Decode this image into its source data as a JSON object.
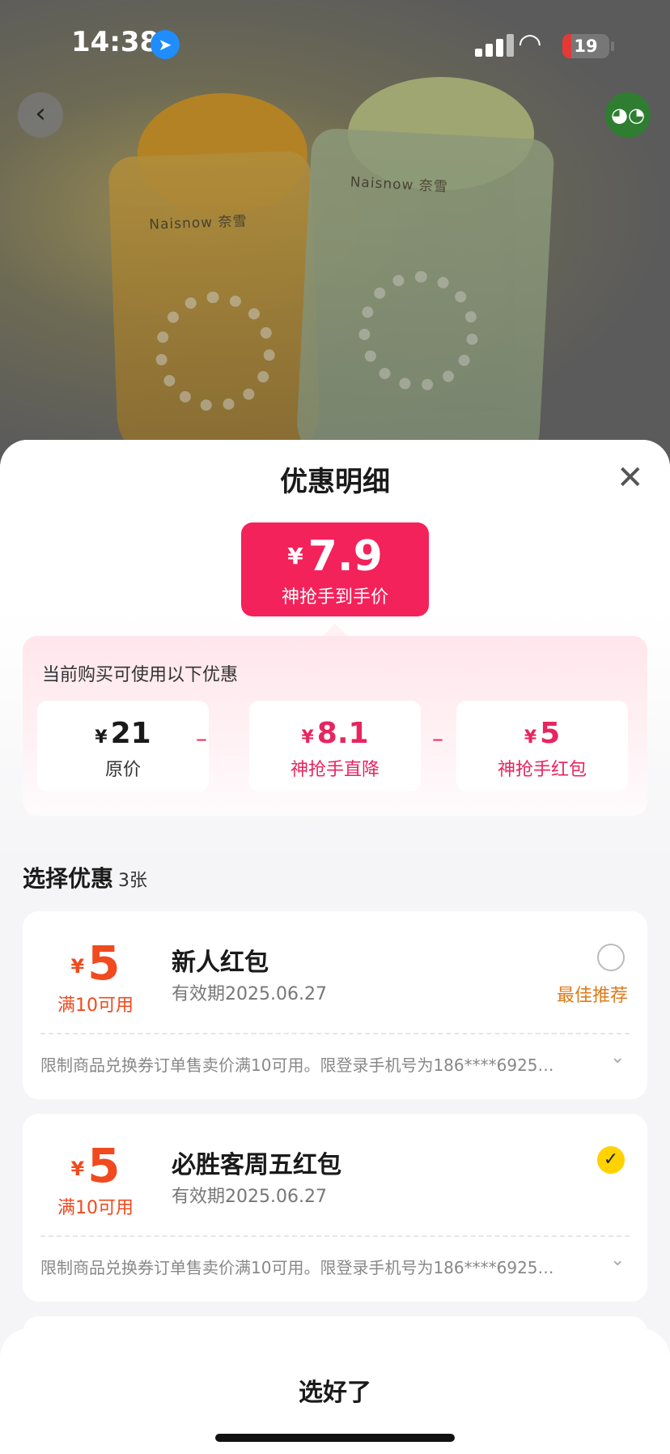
{
  "status_bar": {
    "time": "14:38",
    "battery": "19",
    "battery_level": 0.19
  },
  "hero": {
    "brand": "Naisnow 奈雪"
  },
  "sheet": {
    "title": "优惠明细",
    "final_price": {
      "currency": "¥",
      "amount": "7.9",
      "label": "神抢手到手价"
    },
    "breakdown": {
      "header": "当前购买可使用以下优惠",
      "items": [
        {
          "currency": "¥",
          "value": "21",
          "label": "原价"
        },
        {
          "currency": "¥",
          "value": "8.1",
          "label": "神抢手直降"
        },
        {
          "currency": "¥",
          "value": "5",
          "label": "神抢手红包"
        }
      ],
      "operator": "–"
    },
    "section": {
      "title": "选择优惠",
      "count": "3张"
    },
    "coupons": [
      {
        "currency": "¥",
        "amount": "5",
        "condition": "满10可用",
        "name": "新人红包",
        "expiry": "有效期2025.06.27",
        "badge": "最佳推荐",
        "selected": false,
        "note": "限制商品兑换券订单售卖价满10可用。限登录手机号为186****6925…"
      },
      {
        "currency": "¥",
        "amount": "5",
        "condition": "满10可用",
        "name": "必胜客周五红包",
        "expiry": "有效期2025.06.27",
        "badge": "",
        "selected": true,
        "note": "限制商品兑换券订单售卖价满10可用。限登录手机号为186****6925…"
      }
    ],
    "confirm_label": "选好了"
  },
  "colors": {
    "accent": "#f4225a",
    "coupon": "#f04a1e",
    "recommend": "#e07a18",
    "check": "#ffd200"
  },
  "icons": {
    "back": "chevron-left-icon",
    "share": "wechat-icon",
    "close": "close-icon"
  }
}
